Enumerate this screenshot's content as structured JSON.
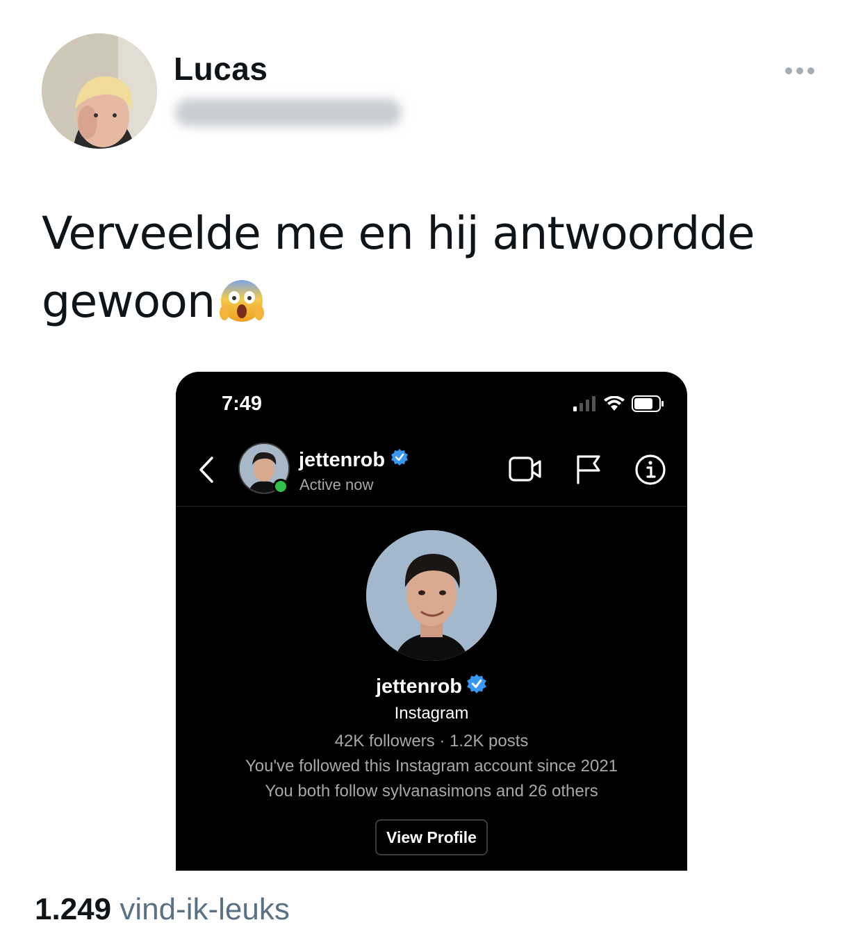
{
  "tweet": {
    "author_name": "Lucas",
    "text_line1": "Verveelde me en hij antwoordde",
    "text_line2": "gewoon",
    "emoji": "😱",
    "likes_count": "1.249",
    "likes_label": "vind-ik-leuks"
  },
  "screenshot": {
    "status_bar": {
      "time": "7:49"
    },
    "chat_header": {
      "username": "jettenrob",
      "status": "Active now"
    },
    "profile": {
      "username": "jettenrob",
      "platform": "Instagram",
      "stats": "42K followers · 1.2K posts",
      "followed_since": "You've followed this Instagram account since 2021",
      "mutuals": "You both follow sylvanasimons and 26 others",
      "view_profile_label": "View Profile"
    }
  },
  "colors": {
    "verified_blue": "#3897f0",
    "online_green": "#2fbf4a",
    "likes_gray": "#5b7083"
  }
}
